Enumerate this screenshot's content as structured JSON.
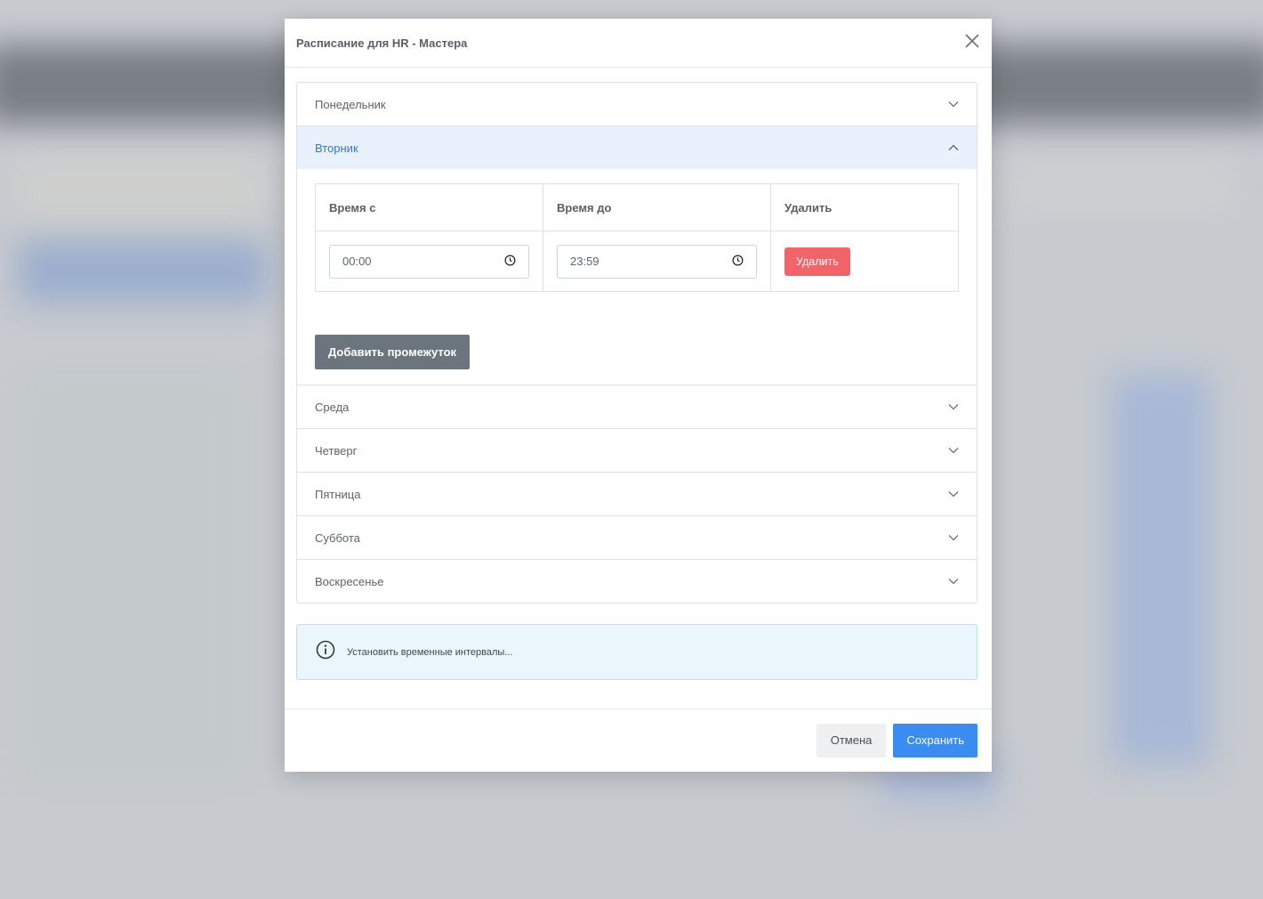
{
  "modal": {
    "title": "Расписание для HR - Мастера"
  },
  "days": {
    "monday": "Понедельник",
    "tuesday": "Вторник",
    "wednesday": "Среда",
    "thursday": "Четверг",
    "friday": "Пятница",
    "saturday": "Суббота",
    "sunday": "Воскресенье"
  },
  "table": {
    "headers": {
      "from": "Время с",
      "to": "Время до",
      "delete": "Удалить"
    },
    "rows": [
      {
        "from": "00:00",
        "to": "23:59",
        "delete_label": "Удалить"
      }
    ]
  },
  "add_interval_label": "Добавить промежуток",
  "info": {
    "text": "Установить временные интервалы..."
  },
  "footer": {
    "cancel_label": "Отмена",
    "save_label": "Сохранить"
  },
  "colors": {
    "accent": "#3a8cf0",
    "danger": "#f0646a",
    "secondary": "#6c757d",
    "active_header_bg": "#e8f1fc"
  },
  "icons": {
    "close": "close-icon",
    "chevron_down": "chevron-down-icon",
    "chevron_up": "chevron-up-icon",
    "clock": "clock-icon",
    "info": "info-icon"
  }
}
